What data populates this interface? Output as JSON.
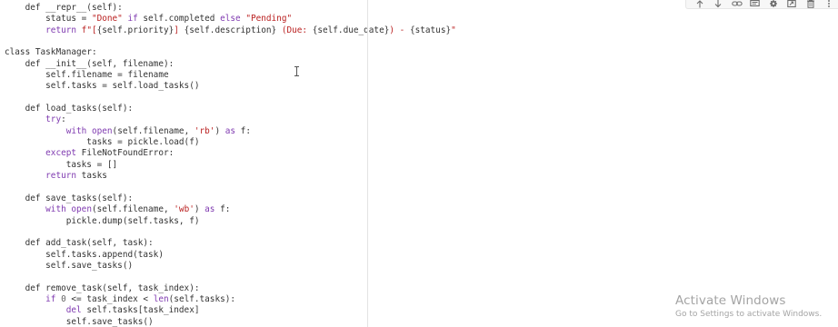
{
  "editor": {
    "code_lines": [
      [
        {
          "t": "    def __repr__(self):",
          "c": "plain"
        }
      ],
      [
        {
          "t": "        status = ",
          "c": "plain"
        },
        {
          "t": "\"Done\"",
          "c": "str"
        },
        {
          "t": " if ",
          "c": "kw"
        },
        {
          "t": "self.completed ",
          "c": "plain"
        },
        {
          "t": "else",
          "c": "kw"
        },
        {
          "t": " ",
          "c": "plain"
        },
        {
          "t": "\"Pending\"",
          "c": "str"
        }
      ],
      [
        {
          "t": "        ",
          "c": "plain"
        },
        {
          "t": "return",
          "c": "kw"
        },
        {
          "t": " f\"[",
          "c": "str"
        },
        {
          "t": "{self.priority}",
          "c": "plain"
        },
        {
          "t": "] ",
          "c": "str"
        },
        {
          "t": "{self.description}",
          "c": "plain"
        },
        {
          "t": " (Due: ",
          "c": "str"
        },
        {
          "t": "{self.due_date}",
          "c": "plain"
        },
        {
          "t": ") - ",
          "c": "str"
        },
        {
          "t": "{status}",
          "c": "plain"
        },
        {
          "t": "\"",
          "c": "str"
        }
      ],
      [
        {
          "t": "",
          "c": "plain"
        }
      ],
      [
        {
          "t": "class",
          "c": "plain"
        },
        {
          "t": " TaskManager:",
          "c": "plain"
        }
      ],
      [
        {
          "t": "    def __init__(self, filename):",
          "c": "plain"
        }
      ],
      [
        {
          "t": "        self.filename = filename",
          "c": "plain"
        }
      ],
      [
        {
          "t": "        self.tasks = self.load_tasks()",
          "c": "plain"
        }
      ],
      [
        {
          "t": "",
          "c": "plain"
        }
      ],
      [
        {
          "t": "    def load_tasks(self):",
          "c": "plain"
        }
      ],
      [
        {
          "t": "        ",
          "c": "plain"
        },
        {
          "t": "try",
          "c": "kw"
        },
        {
          "t": ":",
          "c": "plain"
        }
      ],
      [
        {
          "t": "            ",
          "c": "plain"
        },
        {
          "t": "with",
          "c": "kw"
        },
        {
          "t": " ",
          "c": "plain"
        },
        {
          "t": "open",
          "c": "bi"
        },
        {
          "t": "(self.filename, ",
          "c": "plain"
        },
        {
          "t": "'rb'",
          "c": "str"
        },
        {
          "t": ") ",
          "c": "plain"
        },
        {
          "t": "as",
          "c": "kw"
        },
        {
          "t": " f:",
          "c": "plain"
        }
      ],
      [
        {
          "t": "                tasks = pickle.load(f)",
          "c": "plain"
        }
      ],
      [
        {
          "t": "        ",
          "c": "plain"
        },
        {
          "t": "except",
          "c": "kw"
        },
        {
          "t": " FileNotFoundError:",
          "c": "plain"
        }
      ],
      [
        {
          "t": "            tasks = []",
          "c": "plain"
        }
      ],
      [
        {
          "t": "        ",
          "c": "plain"
        },
        {
          "t": "return",
          "c": "kw"
        },
        {
          "t": " tasks",
          "c": "plain"
        }
      ],
      [
        {
          "t": "",
          "c": "plain"
        }
      ],
      [
        {
          "t": "    def save_tasks(self):",
          "c": "plain"
        }
      ],
      [
        {
          "t": "        ",
          "c": "plain"
        },
        {
          "t": "with",
          "c": "kw"
        },
        {
          "t": " ",
          "c": "plain"
        },
        {
          "t": "open",
          "c": "bi"
        },
        {
          "t": "(self.filename, ",
          "c": "plain"
        },
        {
          "t": "'wb'",
          "c": "str"
        },
        {
          "t": ") ",
          "c": "plain"
        },
        {
          "t": "as",
          "c": "kw"
        },
        {
          "t": " f:",
          "c": "plain"
        }
      ],
      [
        {
          "t": "            pickle.dump(self.tasks, f)",
          "c": "plain"
        }
      ],
      [
        {
          "t": "",
          "c": "plain"
        }
      ],
      [
        {
          "t": "    def add_task(self, task):",
          "c": "plain"
        }
      ],
      [
        {
          "t": "        self.tasks.append(task)",
          "c": "plain"
        }
      ],
      [
        {
          "t": "        self.save_tasks()",
          "c": "plain"
        }
      ],
      [
        {
          "t": "",
          "c": "plain"
        }
      ],
      [
        {
          "t": "    def remove_task(self, task_index):",
          "c": "plain"
        }
      ],
      [
        {
          "t": "        ",
          "c": "plain"
        },
        {
          "t": "if",
          "c": "kw"
        },
        {
          "t": " ",
          "c": "plain"
        },
        {
          "t": "0",
          "c": "num"
        },
        {
          "t": " <= task_index < ",
          "c": "plain"
        },
        {
          "t": "len",
          "c": "bi"
        },
        {
          "t": "(self.tasks):",
          "c": "plain"
        }
      ],
      [
        {
          "t": "            ",
          "c": "plain"
        },
        {
          "t": "del",
          "c": "kw"
        },
        {
          "t": " self.tasks[task_index]",
          "c": "plain"
        }
      ],
      [
        {
          "t": "            self.save_tasks()",
          "c": "plain"
        }
      ]
    ]
  },
  "toolbar": {
    "buttons": [
      {
        "name": "move-up-button",
        "icon": "arrow-up-icon"
      },
      {
        "name": "move-down-button",
        "icon": "arrow-down-icon"
      },
      {
        "name": "link-button",
        "icon": "link-icon"
      },
      {
        "name": "comment-button",
        "icon": "comment-icon"
      },
      {
        "name": "settings-button",
        "icon": "gear-icon"
      },
      {
        "name": "export-button",
        "icon": "export-icon"
      },
      {
        "name": "delete-button",
        "icon": "trash-icon"
      },
      {
        "name": "more-button",
        "icon": "more-vertical-icon"
      }
    ]
  },
  "watermark": {
    "title": "Activate Windows",
    "subtitle": "Go to Settings to activate Windows."
  },
  "colors": {
    "keyword": "#7f3ab0",
    "string": "#ba2121",
    "plain": "#333333",
    "watermark": "#a4a4a4"
  }
}
